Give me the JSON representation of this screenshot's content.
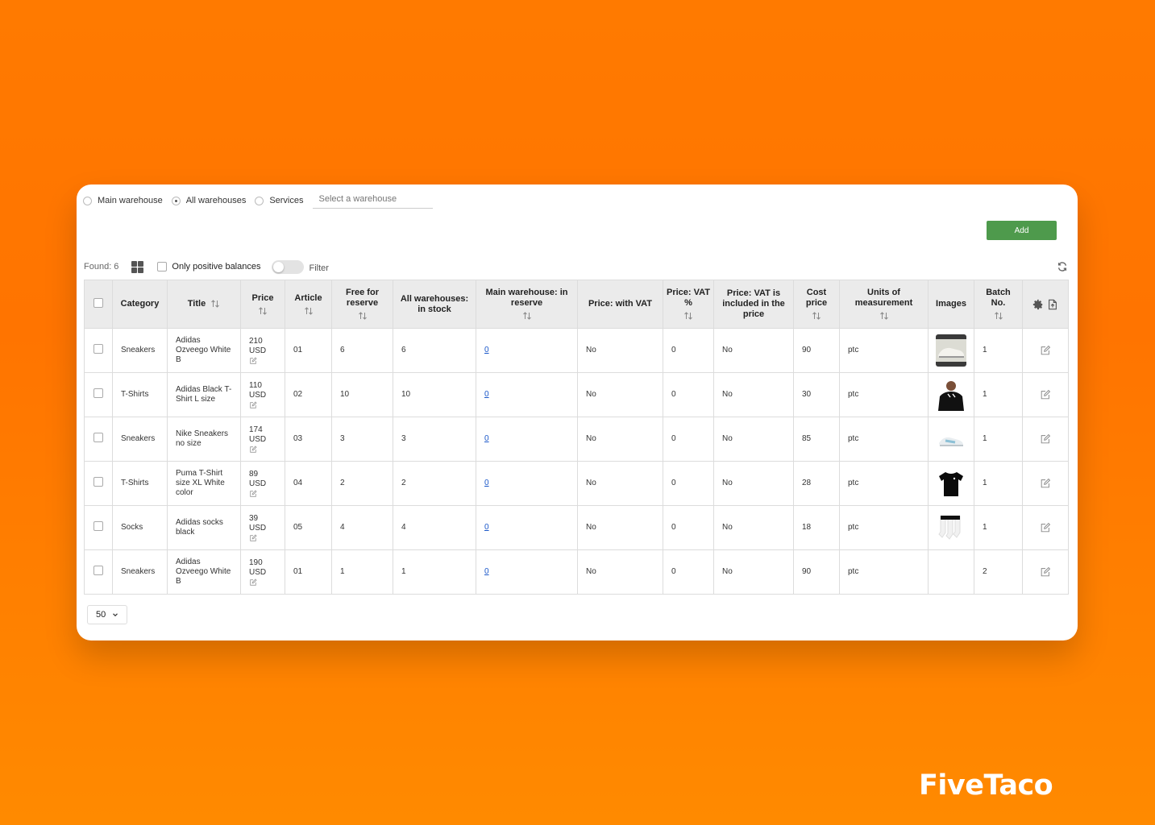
{
  "warehouses": {
    "options": [
      {
        "label": "Main warehouse",
        "selected": false
      },
      {
        "label": "All warehouses",
        "selected": true
      },
      {
        "label": "Services",
        "selected": false
      }
    ],
    "select_placeholder": "Select a warehouse"
  },
  "toolbar": {
    "add_label": "Add",
    "found_label": "Found: 6",
    "positive_label": "Only positive balances",
    "filter_label": "Filter"
  },
  "table": {
    "headers": {
      "category": "Category",
      "title": "Title",
      "price": "Price",
      "article": "Article",
      "free_reserve": "Free for reserve",
      "all_stock": "All warehouses: in stock",
      "main_reserve": "Main warehouse: in reserve",
      "price_vat": "Price: with VAT",
      "vat_percent": "Price: VAT %",
      "vat_included": "Price: VAT is included in the price",
      "cost_price": "Cost price",
      "units": "Units of measurement",
      "images": "Images",
      "batch": "Batch No."
    },
    "rows": [
      {
        "category": "Sneakers",
        "title": "Adidas Ozveego White B",
        "price": "210 USD",
        "article": "01",
        "free": "6",
        "stock": "6",
        "reserve": "0",
        "with_vat": "No",
        "vat": "0",
        "vat_incl": "No",
        "cost": "90",
        "units": "ptc",
        "image": "sneaker-white-thumb",
        "batch": "1"
      },
      {
        "category": "T-Shirts",
        "title": "Adidas Black T-Shirt L size",
        "price": "110 USD",
        "article": "02",
        "free": "10",
        "stock": "10",
        "reserve": "0",
        "with_vat": "No",
        "vat": "0",
        "vat_incl": "No",
        "cost": "30",
        "units": "ptc",
        "image": "black-tshirt-model-thumb",
        "batch": "1"
      },
      {
        "category": "Sneakers",
        "title": "Nike Sneakers no size",
        "price": "174 USD",
        "article": "03",
        "free": "3",
        "stock": "3",
        "reserve": "0",
        "with_vat": "No",
        "vat": "0",
        "vat_incl": "No",
        "cost": "85",
        "units": "ptc",
        "image": "sneaker-blue-thumb",
        "batch": "1"
      },
      {
        "category": "T-Shirts",
        "title": "Puma T-Shirt size XL White color",
        "price": "89 USD",
        "article": "04",
        "free": "2",
        "stock": "2",
        "reserve": "0",
        "with_vat": "No",
        "vat": "0",
        "vat_incl": "No",
        "cost": "28",
        "units": "ptc",
        "image": "black-tshirt-thumb",
        "batch": "1"
      },
      {
        "category": "Socks",
        "title": "Adidas socks black",
        "price": "39 USD",
        "article": "05",
        "free": "4",
        "stock": "4",
        "reserve": "0",
        "with_vat": "No",
        "vat": "0",
        "vat_incl": "No",
        "cost": "18",
        "units": "ptc",
        "image": "socks-thumb",
        "batch": "1"
      },
      {
        "category": "Sneakers",
        "title": "Adidas Ozveego White B",
        "price": "190 USD",
        "article": "01",
        "free": "1",
        "stock": "1",
        "reserve": "0",
        "with_vat": "No",
        "vat": "0",
        "vat_incl": "No",
        "cost": "90",
        "units": "ptc",
        "image": "",
        "batch": "2"
      }
    ]
  },
  "pagination": {
    "page_size": "50"
  },
  "brand": {
    "logo_text": "FiveTaco"
  },
  "colors": {
    "background": "#ff7a00",
    "add_button": "#4e9a4c",
    "link": "#1a57c9",
    "header_bg": "#ebebeb"
  }
}
